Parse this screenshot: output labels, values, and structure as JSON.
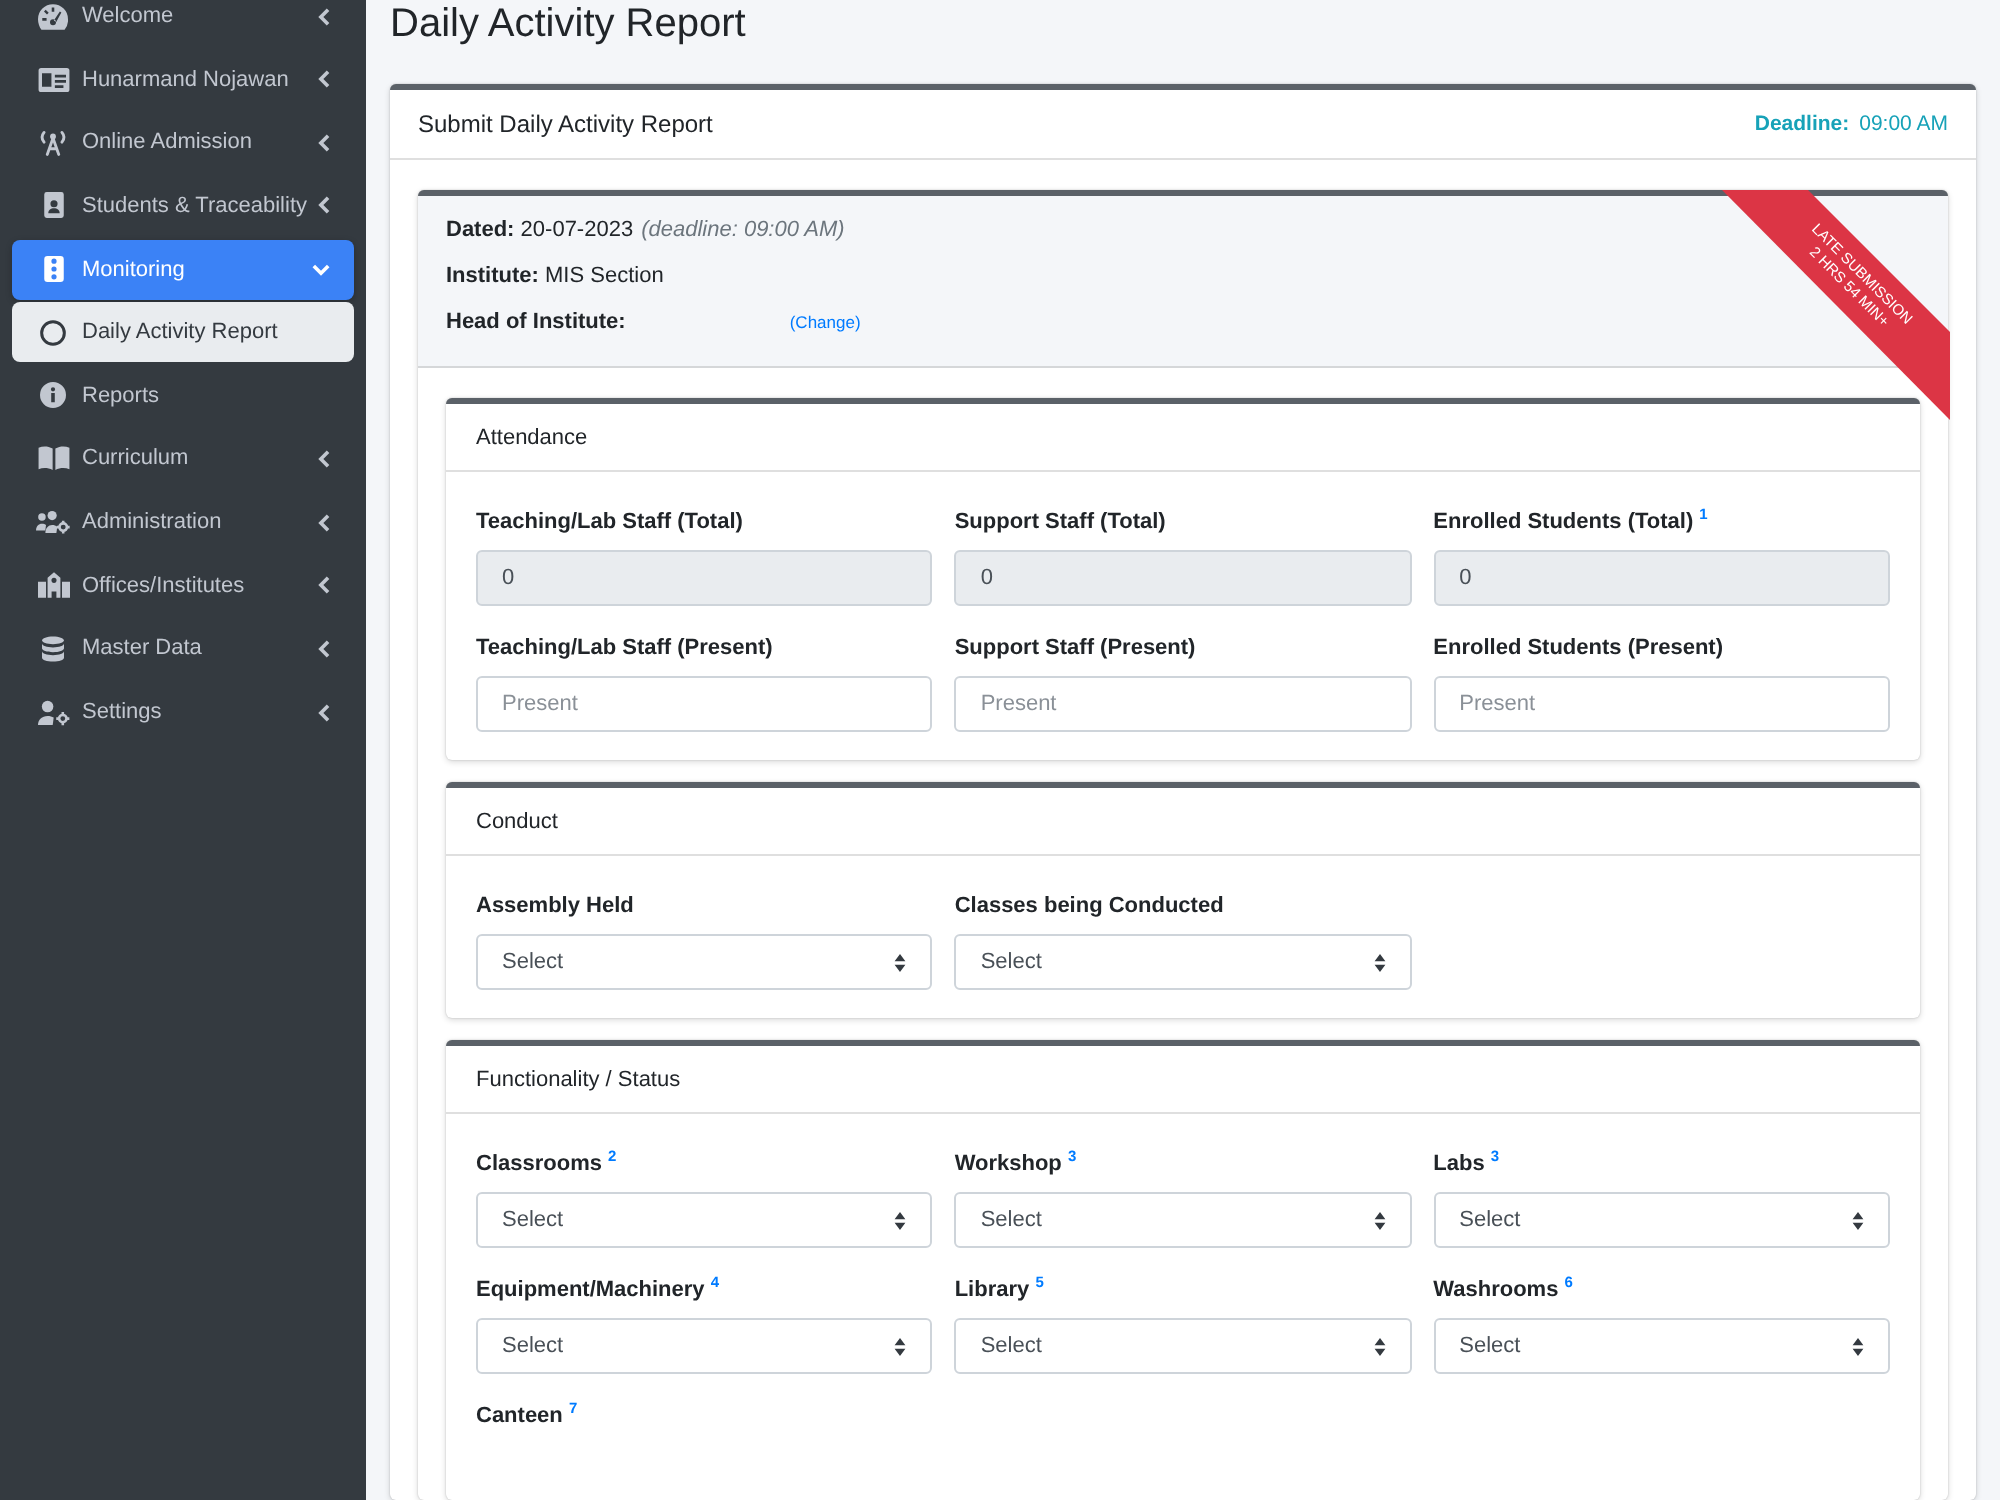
{
  "sidebar": {
    "items": [
      {
        "label": "Welcome",
        "kind": "menu",
        "expanded": false,
        "selected": false
      },
      {
        "label": "Hunarmand Nojawan",
        "kind": "menu",
        "expanded": false,
        "selected": false
      },
      {
        "label": "Online Admission",
        "kind": "menu",
        "expanded": false,
        "selected": false
      },
      {
        "label": "Students & Traceability",
        "kind": "menu",
        "expanded": false,
        "selected": false
      },
      {
        "label": "Monitoring",
        "kind": "menu",
        "expanded": true,
        "selected": true,
        "children": [
          {
            "label": "Daily Activity Report",
            "selected": true
          }
        ]
      },
      {
        "label": "Reports",
        "kind": "link",
        "selected": false
      },
      {
        "label": "Curriculum",
        "kind": "menu",
        "expanded": false,
        "selected": false
      },
      {
        "label": "Administration",
        "kind": "menu",
        "expanded": false,
        "selected": false
      },
      {
        "label": "Offices/Institutes",
        "kind": "menu",
        "expanded": false,
        "selected": false
      },
      {
        "label": "Master Data",
        "kind": "menu",
        "expanded": false,
        "selected": false
      },
      {
        "label": "Settings",
        "kind": "menu",
        "expanded": false,
        "selected": false
      }
    ]
  },
  "page_title": "Daily Activity Report",
  "report_card": {
    "title": "Submit Daily Activity Report",
    "deadline": {
      "label": "Deadline:",
      "value": "09:00 AM"
    },
    "info": {
      "lines": [
        {
          "label": "Dated:",
          "value": "20-07-2023",
          "note": "(deadline: 09:00 AM)"
        },
        {
          "label": "Institute:",
          "value": "MIS Section"
        },
        {
          "label": "Head of Institute:",
          "link": "(Change)"
        }
      ],
      "ribbon": {
        "lines": [
          "LATE SUBMISSION",
          "2 HRS 54 MIN+"
        ]
      }
    },
    "sections": [
      {
        "title": "Attendance",
        "fields": [
          {
            "label": "Teaching/Lab Staff (Total)",
            "kind": "input",
            "value": "0",
            "disabled": true
          },
          {
            "label": "Support Staff (Total)",
            "kind": "input",
            "value": "0",
            "disabled": true
          },
          {
            "label": "Enrolled Students (Total) $^{1}$",
            "kind": "input",
            "value": "0",
            "disabled": true
          },
          {
            "label": "Teaching/Lab Staff (Present)",
            "kind": "input",
            "placeholder": "Present",
            "disabled": false
          },
          {
            "label": "Support Staff (Present)",
            "kind": "input",
            "placeholder": "Present",
            "disabled": false
          },
          {
            "label": "Enrolled Students (Present)",
            "kind": "input",
            "placeholder": "Present",
            "disabled": false
          }
        ]
      },
      {
        "title": "Conduct",
        "fields": [
          {
            "label": "Assembly Held",
            "kind": "select",
            "value": "Select"
          },
          {
            "label": "Classes being Conducted",
            "kind": "select",
            "value": "Select"
          }
        ]
      },
      {
        "title": "Functionality / Status",
        "fields": [
          {
            "label": "Classrooms $^{2}$",
            "kind": "select",
            "value": "Select"
          },
          {
            "label": "Workshop $^{3}$",
            "kind": "select",
            "value": "Select"
          },
          {
            "label": "Labs $^{3}$",
            "kind": "select",
            "value": "Select"
          },
          {
            "label": "Equipment/Machinery $^{4}$",
            "kind": "select",
            "value": "Select"
          },
          {
            "label": "Library $^{5}$",
            "kind": "select",
            "value": "Select"
          },
          {
            "label": "Washrooms $^{6}$",
            "kind": "select",
            "value": "Select"
          },
          {
            "label": "Canteen $^{7}$",
            "kind": "label"
          }
        ]
      }
    ]
  }
}
